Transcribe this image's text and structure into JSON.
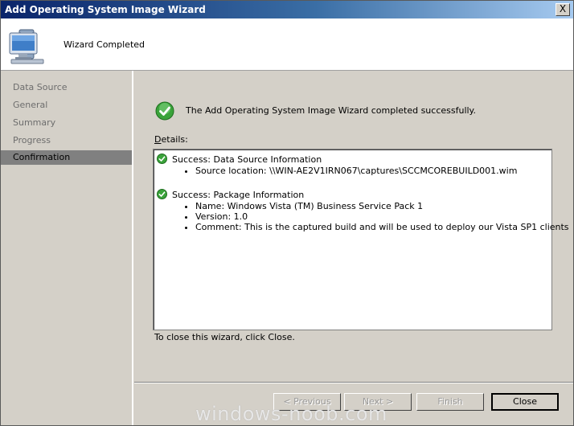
{
  "window": {
    "title": "Add Operating System Image Wizard",
    "close_glyph": "X"
  },
  "header": {
    "title": "Wizard Completed",
    "icon": "computer-icon"
  },
  "sidebar": {
    "items": [
      {
        "label": "Data Source"
      },
      {
        "label": "General"
      },
      {
        "label": "Summary"
      },
      {
        "label": "Progress"
      },
      {
        "label": "Confirmation",
        "active": true
      }
    ]
  },
  "main": {
    "success_message": "The Add Operating System Image Wizard completed successfully.",
    "details_label_accel": "D",
    "details_label_rest": "etails:",
    "details": [
      {
        "title": "Success: Data Source Information",
        "items": [
          "Source location: \\\\WIN-AE2V1IRN067\\captures\\SCCMCOREBUILD001.wim"
        ]
      },
      {
        "title": "Success: Package Information",
        "items": [
          "Name: Windows Vista (TM) Business Service Pack 1",
          "Version: 1.0",
          "Comment: This is the captured build and will be used to deploy our Vista SP1 clients"
        ]
      }
    ],
    "close_hint": "To close this wizard, click Close."
  },
  "buttons": {
    "previous": "< Previous",
    "next": "Next >",
    "finish": "Finish",
    "close": "Close"
  },
  "watermark": "windows-noob.com",
  "colors": {
    "titlebar_start": "#0a246a",
    "titlebar_end": "#a6caf0",
    "success_green": "#3aa33a",
    "active_nav": "#808080"
  }
}
